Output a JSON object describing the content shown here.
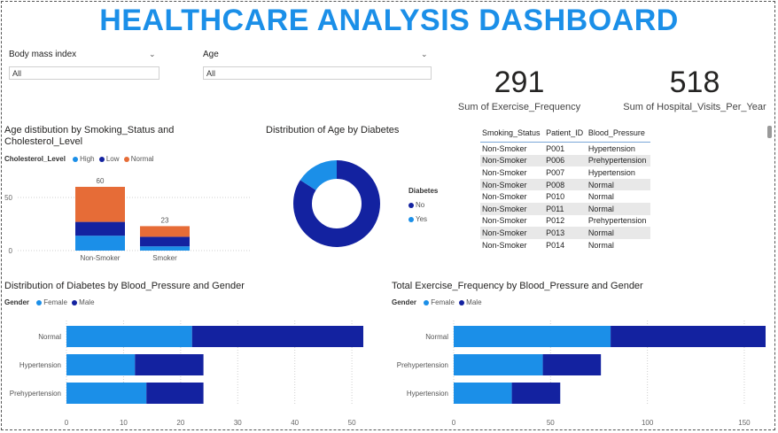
{
  "title": "HEALTHCARE ANALYSIS DASHBOARD",
  "colors": {
    "title": "#1b8fe8",
    "high": "#1b8fe8",
    "low": "#1322a0",
    "normal": "#e66c37",
    "female": "#1b8fe8",
    "male": "#1322a0"
  },
  "slicers": [
    {
      "label": "Body mass index",
      "value": "All"
    },
    {
      "label": "Age",
      "value": "All"
    }
  ],
  "kpis": [
    {
      "value": "291",
      "label": "Sum of Exercise_Frequency"
    },
    {
      "value": "518",
      "label": "Sum of Hospital_Visits_Per_Year"
    }
  ],
  "chart_data": [
    {
      "type": "bar",
      "title_line1": "Age distibution by Smoking_Status and",
      "title_line2": "Cholesterol_Level",
      "legend_title": "Cholesterol_Level",
      "categories": [
        "Non-Smoker",
        "Smoker"
      ],
      "series": [
        {
          "name": "High",
          "values": [
            14,
            4
          ]
        },
        {
          "name": "Low",
          "values": [
            13,
            9
          ]
        },
        {
          "name": "Normal",
          "values": [
            33,
            10
          ]
        }
      ],
      "totals": [
        "60",
        "23"
      ],
      "yticks": [
        "0",
        "50"
      ],
      "ylim": [
        0,
        70
      ]
    },
    {
      "type": "pie",
      "title": "Distribution of Age by Diabetes",
      "legend_title": "Diabetes",
      "slices": [
        {
          "name": "No",
          "value": 84
        },
        {
          "name": "Yes",
          "value": 16
        }
      ]
    },
    {
      "type": "bar",
      "orientation": "horizontal",
      "title": "Distribution of Diabetes by Blood_Pressure and Gender",
      "legend_title": "Gender",
      "categories": [
        "Normal",
        "Hypertension",
        "Prehypertension"
      ],
      "series": [
        {
          "name": "Female",
          "values": [
            22,
            12,
            14
          ]
        },
        {
          "name": "Male",
          "values": [
            30,
            12,
            10
          ]
        }
      ],
      "xticks": [
        "0",
        "10",
        "20",
        "30",
        "40",
        "50"
      ],
      "xlim": [
        0,
        52
      ]
    },
    {
      "type": "bar",
      "orientation": "horizontal",
      "title": "Total Exercise_Frequency by Blood_Pressure and Gender",
      "legend_title": "Gender",
      "categories": [
        "Normal",
        "Prehypertension",
        "Hypertension"
      ],
      "series": [
        {
          "name": "Female",
          "values": [
            81,
            46,
            30
          ]
        },
        {
          "name": "Male",
          "values": [
            80,
            30,
            25
          ]
        }
      ],
      "xticks": [
        "0",
        "50",
        "100",
        "150"
      ],
      "xlim": [
        0,
        161
      ]
    }
  ],
  "table": {
    "columns": [
      "Smoking_Status",
      "Patient_ID",
      "Blood_Pressure"
    ],
    "rows": [
      [
        "Non-Smoker",
        "P001",
        "Hypertension"
      ],
      [
        "Non-Smoker",
        "P006",
        "Prehypertension"
      ],
      [
        "Non-Smoker",
        "P007",
        "Hypertension"
      ],
      [
        "Non-Smoker",
        "P008",
        "Normal"
      ],
      [
        "Non-Smoker",
        "P010",
        "Normal"
      ],
      [
        "Non-Smoker",
        "P011",
        "Normal"
      ],
      [
        "Non-Smoker",
        "P012",
        "Prehypertension"
      ],
      [
        "Non-Smoker",
        "P013",
        "Normal"
      ],
      [
        "Non-Smoker",
        "P014",
        "Normal"
      ]
    ]
  }
}
